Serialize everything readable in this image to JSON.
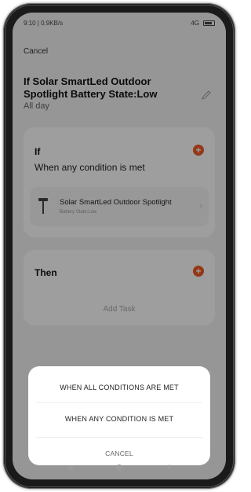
{
  "status_bar": {
    "left": "9:10 | 0.9KB/s",
    "right": "4G"
  },
  "header": {
    "cancel_label": "Cancel",
    "scene_title": "If Solar SmartLed Outdoor Spotlight Battery State:Low",
    "scene_subtitle": "All day"
  },
  "if_section": {
    "heading": "If",
    "condition_mode": "When any condition is met",
    "add_icon": "plus-icon",
    "condition": {
      "device_name": "Solar SmartLed Outdoor Spotlight",
      "state": "Battery State:Low",
      "icon": "spotlight-icon"
    }
  },
  "then_section": {
    "heading": "Then",
    "add_task_label": "Add Task",
    "add_icon": "plus-icon"
  },
  "action_sheet": {
    "option_all": "WHEN ALL CONDITIONS ARE MET",
    "option_any": "WHEN ANY CONDITION IS MET",
    "cancel": "CANCEL"
  },
  "colors": {
    "accent": "#f05a23",
    "card_bg": "#ffffff",
    "page_bg": "#f3f3f3"
  }
}
